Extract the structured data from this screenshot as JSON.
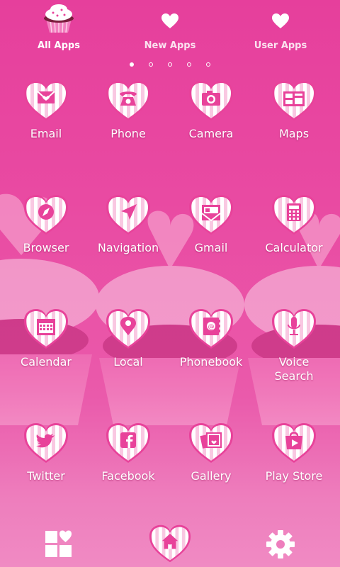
{
  "tabs": [
    {
      "label": "All Apps",
      "icon": "cupcake-icon"
    },
    {
      "label": "New Apps",
      "icon": "heart-icon"
    },
    {
      "label": "User Apps",
      "icon": "heart-icon"
    }
  ],
  "page_indicator": {
    "total": 5,
    "current": 1
  },
  "apps": [
    {
      "label": "Email",
      "icon": "envelope-heart-icon"
    },
    {
      "label": "Phone",
      "icon": "telephone-icon"
    },
    {
      "label": "Camera",
      "icon": "camera-icon"
    },
    {
      "label": "Maps",
      "icon": "map-icon"
    },
    {
      "label": "Browser",
      "icon": "compass-icon"
    },
    {
      "label": "Navigation",
      "icon": "navigation-arrow-icon"
    },
    {
      "label": "Gmail",
      "icon": "mail-card-icon"
    },
    {
      "label": "Calculator",
      "icon": "calculator-icon"
    },
    {
      "label": "Calendar",
      "icon": "calendar-icon"
    },
    {
      "label": "Local",
      "icon": "location-pin-icon"
    },
    {
      "label": "Phonebook",
      "icon": "contacts-book-icon"
    },
    {
      "label": "Voice\nSearch",
      "icon": "microphone-icon"
    },
    {
      "label": "Twitter",
      "icon": "twitter-bird-icon"
    },
    {
      "label": "Facebook",
      "icon": "facebook-icon"
    },
    {
      "label": "Gallery",
      "icon": "photos-icon"
    },
    {
      "label": "Play Store",
      "icon": "play-store-icon"
    }
  ],
  "dock": {
    "left_icon": "widgets-icon",
    "center_icon": "home-icon",
    "right_icon": "gear-icon"
  },
  "colors": {
    "background": "#e63f9c",
    "icon_tint": "#e8429a",
    "heart_stripe": "#f9c8e2",
    "text": "#ffffff"
  }
}
